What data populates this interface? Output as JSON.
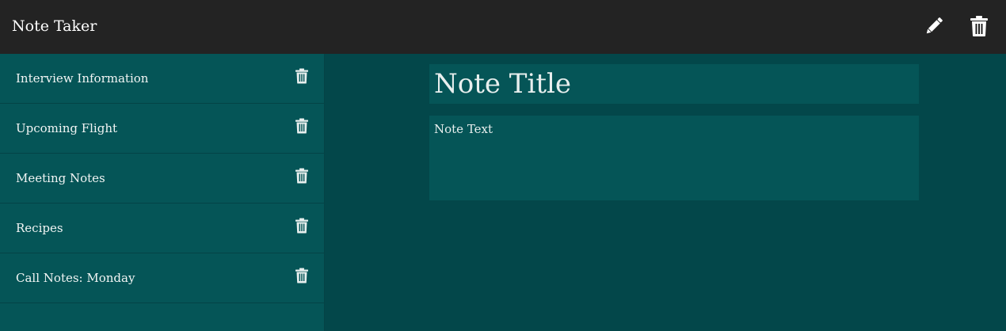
{
  "app": {
    "title": "Note Taker",
    "icons": {
      "edit": "pencil-icon",
      "delete": "trash-icon"
    }
  },
  "sidebar": {
    "items": [
      {
        "label": "Interview Information"
      },
      {
        "label": "Upcoming Flight"
      },
      {
        "label": "Meeting Notes"
      },
      {
        "label": "Recipes"
      },
      {
        "label": "Call Notes: Monday"
      }
    ]
  },
  "editor": {
    "title_placeholder": "Note Title",
    "text_placeholder": "Note Text"
  },
  "colors": {
    "topbar": "#232323",
    "sidebar": "#055557",
    "main": "#03474a",
    "text": "#e8efee"
  }
}
